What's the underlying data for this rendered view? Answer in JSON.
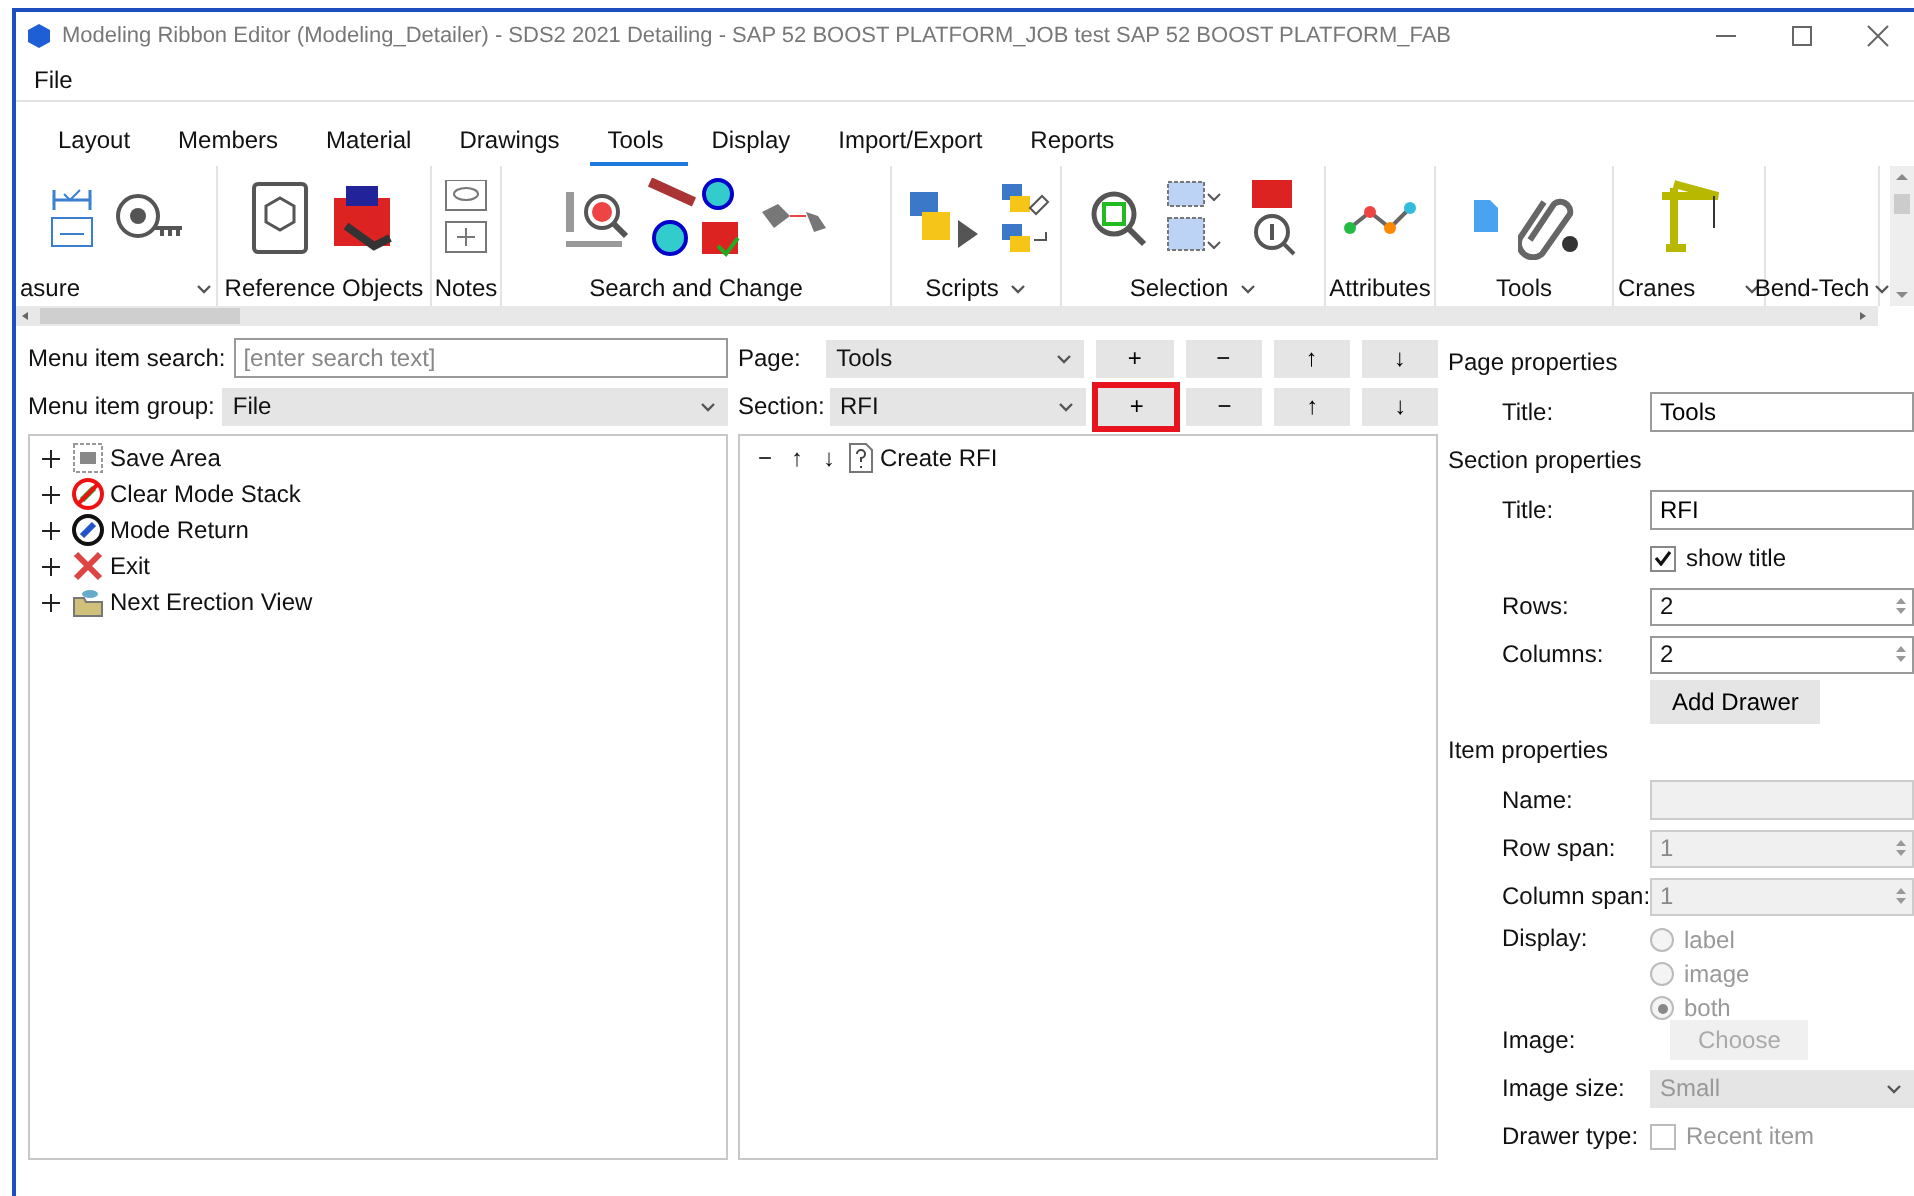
{
  "window": {
    "title": "Modeling Ribbon Editor (Modeling_Detailer) - SDS2 2021 Detailing - SAP 52 BOOST PLATFORM_JOB test  SAP 52 BOOST PLATFORM_FAB"
  },
  "menu": [
    "File"
  ],
  "tabs": [
    {
      "label": "Layout",
      "selected": false
    },
    {
      "label": "Members",
      "selected": false
    },
    {
      "label": "Material",
      "selected": false
    },
    {
      "label": "Drawings",
      "selected": false
    },
    {
      "label": "Tools",
      "selected": true
    },
    {
      "label": "Display",
      "selected": false
    },
    {
      "label": "Import/Export",
      "selected": false
    },
    {
      "label": "Reports",
      "selected": false
    }
  ],
  "ribbon_groups": [
    {
      "label": "asure",
      "menu": true
    },
    {
      "label": "Reference Objects",
      "menu": false
    },
    {
      "label": "Notes",
      "menu": false
    },
    {
      "label": "Search and Change",
      "menu": false
    },
    {
      "label": "Scripts",
      "menu": true
    },
    {
      "label": "Selection",
      "menu": true
    },
    {
      "label": "Attributes",
      "menu": false
    },
    {
      "label": "Tools",
      "menu": false
    },
    {
      "label": "Cranes",
      "menu": true
    },
    {
      "label": "Bend-Tech",
      "menu": true
    }
  ],
  "left": {
    "search": {
      "label": "Menu item search:",
      "placeholder": "[enter search text]"
    },
    "group": {
      "label": "Menu item group:",
      "value": "File"
    },
    "tree": [
      {
        "label": "Save Area",
        "expanded": false
      },
      {
        "label": "Clear Mode Stack",
        "expanded": false
      },
      {
        "label": "Mode Return",
        "expanded": false
      },
      {
        "label": "Exit",
        "expanded": false
      },
      {
        "label": "Next Erection View",
        "expanded": false
      }
    ]
  },
  "middle": {
    "rows": [
      {
        "label": "Page:",
        "value": "Tools",
        "buttons": [
          {
            "label": "+",
            "highlighted": false
          },
          {
            "label": "−",
            "highlighted": false
          },
          {
            "label": "↑",
            "highlighted": false
          },
          {
            "label": "↓",
            "highlighted": false
          }
        ]
      },
      {
        "label": "Section:",
        "value": "RFI",
        "buttons": [
          {
            "label": "+",
            "highlighted": true
          },
          {
            "label": "−",
            "highlighted": false
          },
          {
            "label": "↑",
            "highlighted": false
          },
          {
            "label": "↓",
            "highlighted": false
          }
        ]
      }
    ],
    "items": [
      {
        "controls": [
          "−",
          "↑",
          "↓"
        ],
        "label": "Create RFI"
      }
    ]
  },
  "properties": [
    {
      "heading": "Page properties",
      "rows": [
        {
          "kind": "text",
          "label": "Title:",
          "value": "Tools",
          "disabled": false
        }
      ]
    },
    {
      "heading": "Section properties",
      "rows": [
        {
          "kind": "text",
          "label": "Title:",
          "value": "RFI",
          "disabled": false
        },
        {
          "kind": "checkbox",
          "text": "show title",
          "checked": true,
          "disabled": false
        },
        {
          "kind": "spin",
          "label": "Rows:",
          "value": "2",
          "disabled": false
        },
        {
          "kind": "spin",
          "label": "Columns:",
          "value": "2",
          "disabled": false
        },
        {
          "kind": "button",
          "text": "Add Drawer",
          "disabled": false
        }
      ]
    },
    {
      "heading": "Item properties",
      "rows": [
        {
          "kind": "text",
          "label": "Name:",
          "disabled": true
        },
        {
          "kind": "spin",
          "label": "Row span:",
          "value": "1",
          "disabled": true
        },
        {
          "kind": "spin",
          "label": "Column span:",
          "value": "1",
          "disabled": true
        },
        {
          "kind": "radio",
          "label": "Display:",
          "disabled": true,
          "options": [
            {
              "label": "label",
              "selected": false
            },
            {
              "label": "image",
              "selected": false
            },
            {
              "label": "both",
              "selected": true
            }
          ]
        },
        {
          "kind": "button",
          "label": "Image:",
          "text": "Choose",
          "disabled": true
        },
        {
          "kind": "select",
          "label": "Image size:",
          "value": "Small",
          "disabled": true
        },
        {
          "kind": "checkbox",
          "label": "Drawer type:",
          "text": "Recent item",
          "checked": false,
          "disabled": true
        }
      ]
    }
  ]
}
